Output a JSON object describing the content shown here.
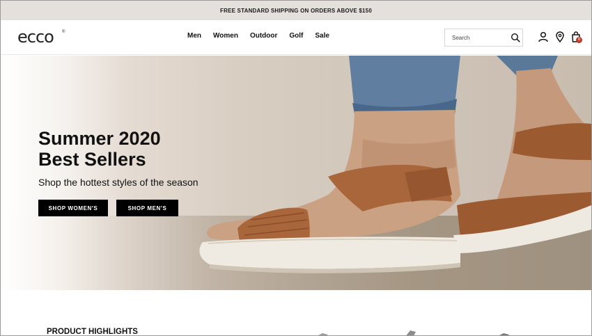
{
  "promo": {
    "text": "FREE STANDARD SHIPPING ON ORDERS ABOVE $150"
  },
  "header": {
    "logo": "ecco",
    "nav": [
      "Men",
      "Women",
      "Outdoor",
      "Golf",
      "Sale"
    ],
    "search_placeholder": "Search",
    "icons": [
      "search-icon",
      "account-icon",
      "store-locator-icon",
      "bag-icon"
    ],
    "cart_count": "0"
  },
  "hero": {
    "title_line1": "Summer 2020",
    "title_line2": "Best Sellers",
    "subtitle": "Shop the hottest styles of the season",
    "button_women": "SHOP WOMEN'S",
    "button_men": "SHOP MEN'S"
  },
  "highlights": {
    "title": "PRODUCT HIGHLIGHTS"
  },
  "colors": {
    "banner_bg": "#e4e1dc",
    "button_bg": "#000000",
    "badge": "#c0392b",
    "sandal": "#a8663a"
  }
}
